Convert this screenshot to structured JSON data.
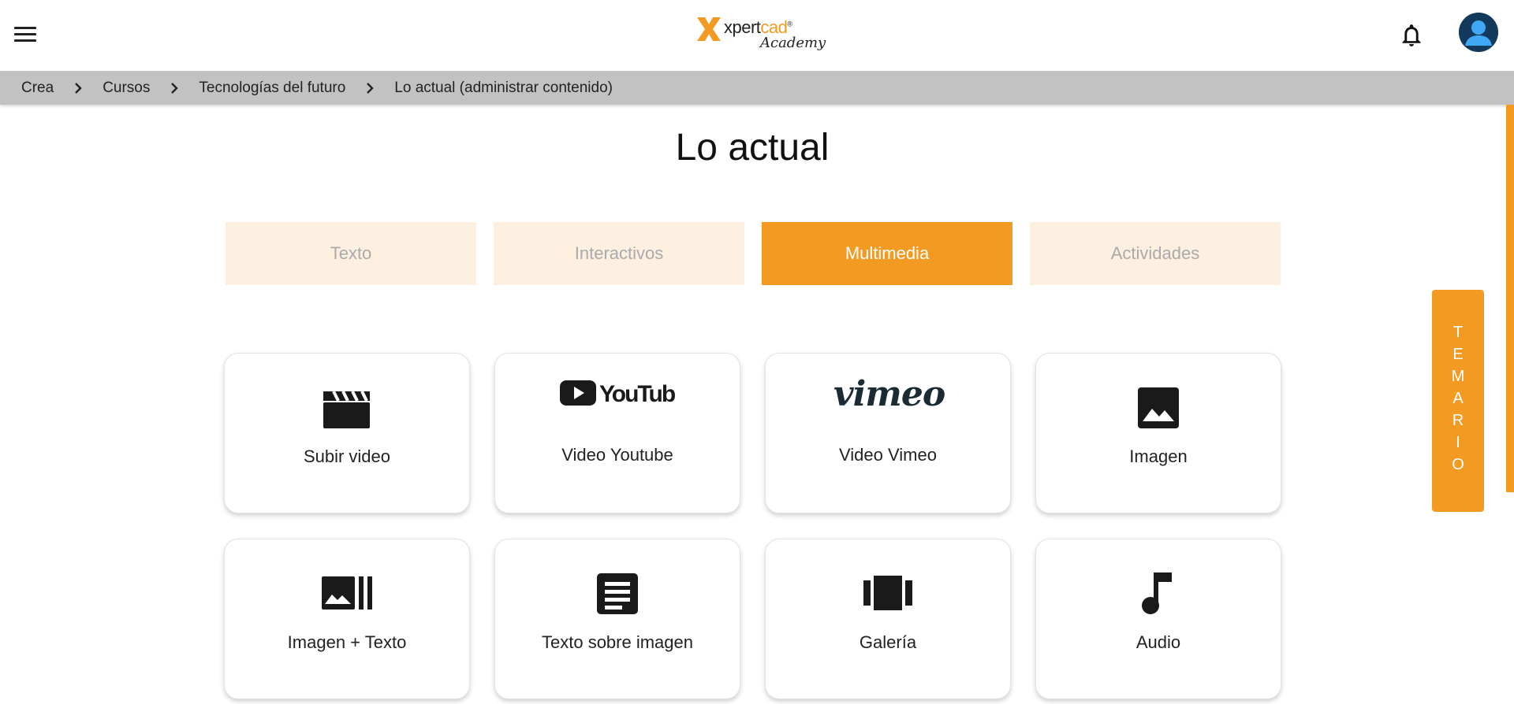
{
  "header": {
    "logo": {
      "mark": "X",
      "word_a": "xpert",
      "word_b": "cad",
      "registered": "®",
      "sub": "Academy"
    },
    "menu_icon": "hamburger-icon",
    "bell_icon": "bell-icon",
    "avatar_icon": "user-avatar-icon"
  },
  "breadcrumb": [
    "Crea",
    "Cursos",
    "Tecnologías del futuro",
    "Lo actual (administrar contenido)"
  ],
  "page": {
    "title": "Lo actual"
  },
  "tabs": [
    {
      "label": "Texto",
      "active": false
    },
    {
      "label": "Interactivos",
      "active": false
    },
    {
      "label": "Multimedia",
      "active": true
    },
    {
      "label": "Actividades",
      "active": false
    }
  ],
  "cards": [
    {
      "label": "Subir video",
      "icon": "movie-clapper-icon"
    },
    {
      "label": "Video Youtube",
      "icon": "youtube-logo-icon",
      "brand": "YouTube"
    },
    {
      "label": "Video Vimeo",
      "icon": "vimeo-logo-icon",
      "brand": "vimeo"
    },
    {
      "label": "Imagen",
      "icon": "image-icon"
    },
    {
      "label": "Imagen + Texto",
      "icon": "image-text-icon"
    },
    {
      "label": "Texto sobre imagen",
      "icon": "article-icon"
    },
    {
      "label": "Galería",
      "icon": "gallery-carousel-icon"
    },
    {
      "label": "Audio",
      "icon": "music-note-icon"
    }
  ],
  "side_panel": {
    "label": "TEMARIO"
  },
  "colors": {
    "accent": "#F29A21",
    "tab_inactive_bg": "#fdf0e1",
    "breadcrumb_bg": "#c2c2c2"
  }
}
